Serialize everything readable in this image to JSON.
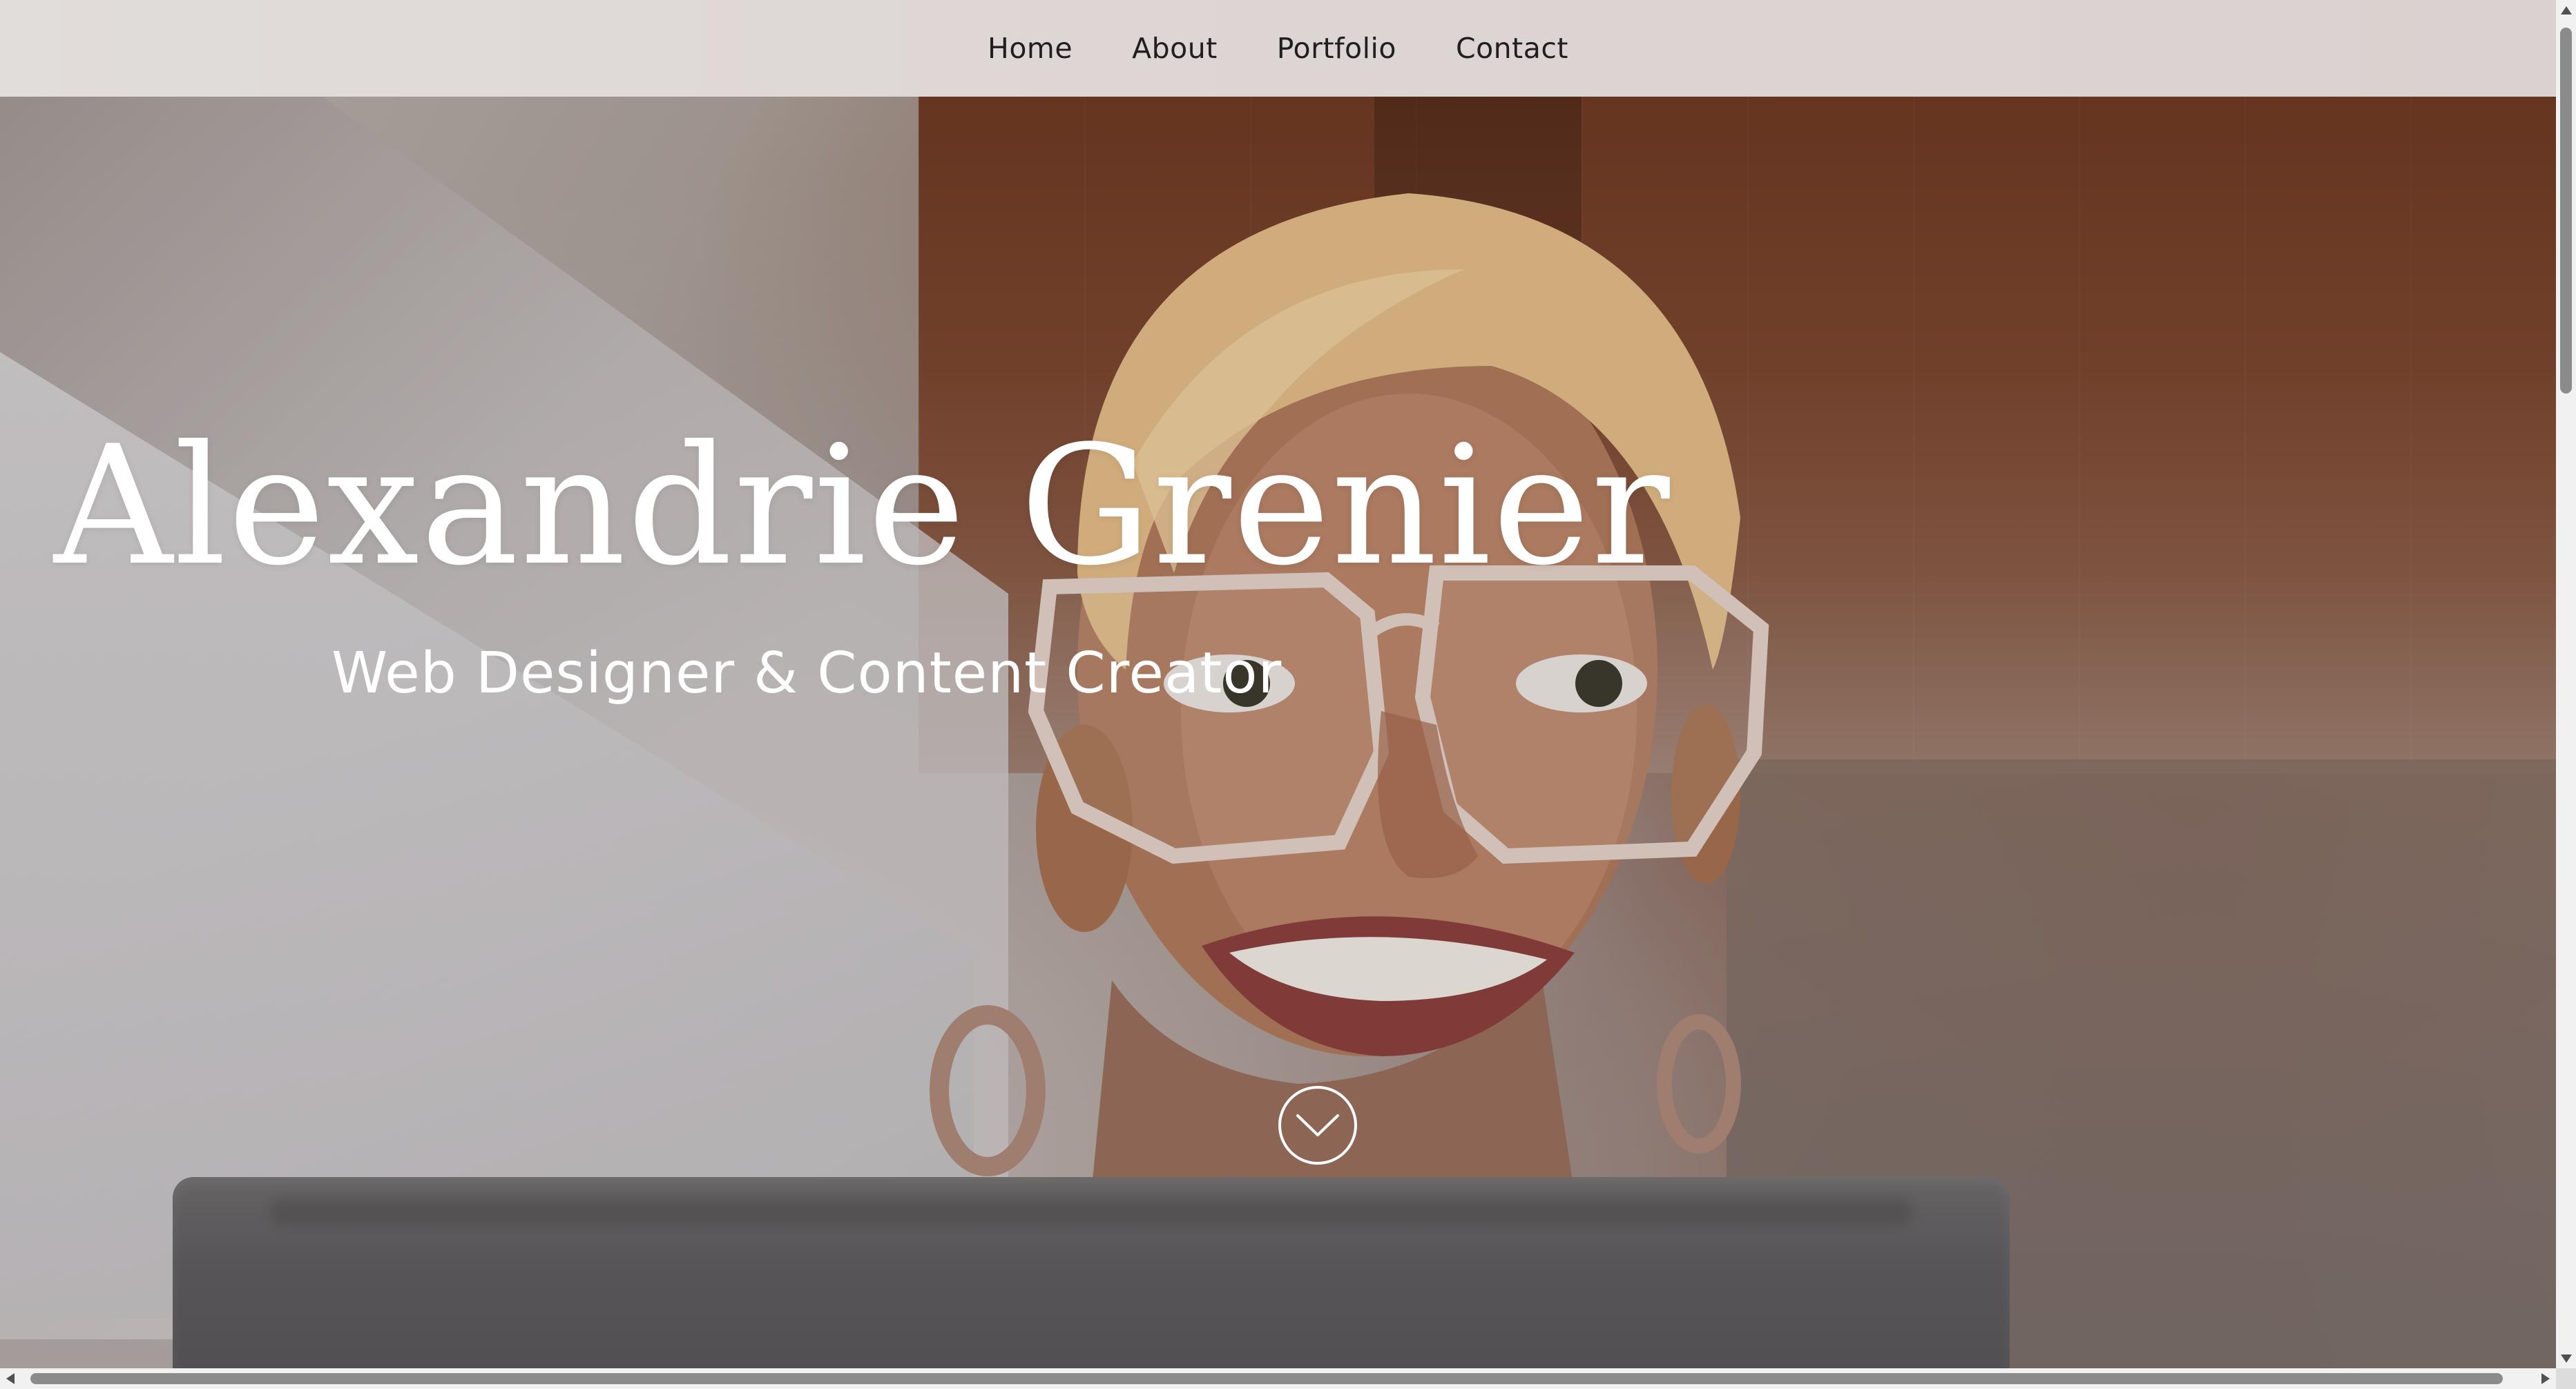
{
  "nav": {
    "items": [
      {
        "label": "Home"
      },
      {
        "label": "About"
      },
      {
        "label": "Portfolio"
      },
      {
        "label": "Contact"
      }
    ]
  },
  "hero": {
    "title": "Alexandrie Grenier",
    "subtitle": "Web Designer & Content Creator",
    "scroll_icon": "chevron-down-icon"
  },
  "colors": {
    "nav_background": "#ddd5d4",
    "nav_text": "#1f1f1f",
    "hero_text": "#ffffff",
    "scrollbar_thumb": "#8b8b8b",
    "scrollbar_track": "#f1f1f1"
  }
}
